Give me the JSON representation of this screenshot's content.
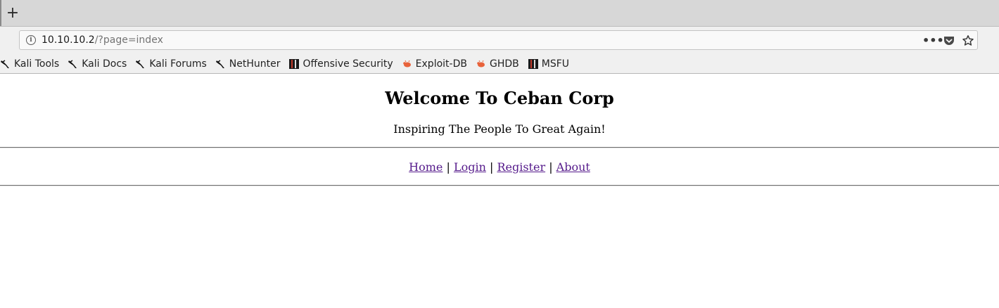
{
  "browser": {
    "newtab_glyph": "+",
    "url_host": "10.10.10.2",
    "url_path": "/?page=index",
    "more_glyph": "•••"
  },
  "bookmarks": [
    {
      "label": "Kali Tools",
      "icon": "kali-dragon-icon"
    },
    {
      "label": "Kali Docs",
      "icon": "kali-dragon-icon"
    },
    {
      "label": "Kali Forums",
      "icon": "kali-dragon-icon"
    },
    {
      "label": "NetHunter",
      "icon": "kali-dragon-icon"
    },
    {
      "label": "Offensive Security",
      "icon": "offsec-icon"
    },
    {
      "label": "Exploit-DB",
      "icon": "exploitdb-bug-icon"
    },
    {
      "label": "GHDB",
      "icon": "exploitdb-bug-icon"
    },
    {
      "label": "MSFU",
      "icon": "offsec-icon"
    }
  ],
  "page": {
    "title": "Welcome To Ceban Corp",
    "tagline": "Inspiring The People To Great Again!",
    "nav": [
      {
        "label": "Home"
      },
      {
        "label": "Login"
      },
      {
        "label": "Register"
      },
      {
        "label": "About"
      }
    ],
    "separator": "|"
  },
  "colors": {
    "visited_link": "#551a8b",
    "bug_icon": "#e8623a"
  }
}
